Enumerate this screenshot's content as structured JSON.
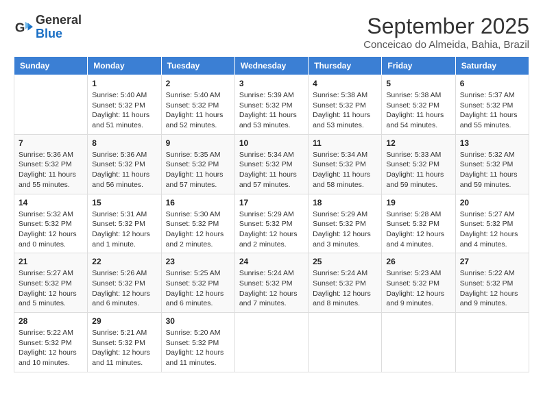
{
  "app": {
    "logo_line1": "General",
    "logo_line2": "Blue"
  },
  "header": {
    "month": "September 2025",
    "location": "Conceicao do Almeida, Bahia, Brazil"
  },
  "weekdays": [
    "Sunday",
    "Monday",
    "Tuesday",
    "Wednesday",
    "Thursday",
    "Friday",
    "Saturday"
  ],
  "weeks": [
    [
      {
        "day": "",
        "info": ""
      },
      {
        "day": "1",
        "info": "Sunrise: 5:40 AM\nSunset: 5:32 PM\nDaylight: 11 hours\nand 51 minutes."
      },
      {
        "day": "2",
        "info": "Sunrise: 5:40 AM\nSunset: 5:32 PM\nDaylight: 11 hours\nand 52 minutes."
      },
      {
        "day": "3",
        "info": "Sunrise: 5:39 AM\nSunset: 5:32 PM\nDaylight: 11 hours\nand 53 minutes."
      },
      {
        "day": "4",
        "info": "Sunrise: 5:38 AM\nSunset: 5:32 PM\nDaylight: 11 hours\nand 53 minutes."
      },
      {
        "day": "5",
        "info": "Sunrise: 5:38 AM\nSunset: 5:32 PM\nDaylight: 11 hours\nand 54 minutes."
      },
      {
        "day": "6",
        "info": "Sunrise: 5:37 AM\nSunset: 5:32 PM\nDaylight: 11 hours\nand 55 minutes."
      }
    ],
    [
      {
        "day": "7",
        "info": "Sunrise: 5:36 AM\nSunset: 5:32 PM\nDaylight: 11 hours\nand 55 minutes."
      },
      {
        "day": "8",
        "info": "Sunrise: 5:36 AM\nSunset: 5:32 PM\nDaylight: 11 hours\nand 56 minutes."
      },
      {
        "day": "9",
        "info": "Sunrise: 5:35 AM\nSunset: 5:32 PM\nDaylight: 11 hours\nand 57 minutes."
      },
      {
        "day": "10",
        "info": "Sunrise: 5:34 AM\nSunset: 5:32 PM\nDaylight: 11 hours\nand 57 minutes."
      },
      {
        "day": "11",
        "info": "Sunrise: 5:34 AM\nSunset: 5:32 PM\nDaylight: 11 hours\nand 58 minutes."
      },
      {
        "day": "12",
        "info": "Sunrise: 5:33 AM\nSunset: 5:32 PM\nDaylight: 11 hours\nand 59 minutes."
      },
      {
        "day": "13",
        "info": "Sunrise: 5:32 AM\nSunset: 5:32 PM\nDaylight: 11 hours\nand 59 minutes."
      }
    ],
    [
      {
        "day": "14",
        "info": "Sunrise: 5:32 AM\nSunset: 5:32 PM\nDaylight: 12 hours\nand 0 minutes."
      },
      {
        "day": "15",
        "info": "Sunrise: 5:31 AM\nSunset: 5:32 PM\nDaylight: 12 hours\nand 1 minute."
      },
      {
        "day": "16",
        "info": "Sunrise: 5:30 AM\nSunset: 5:32 PM\nDaylight: 12 hours\nand 2 minutes."
      },
      {
        "day": "17",
        "info": "Sunrise: 5:29 AM\nSunset: 5:32 PM\nDaylight: 12 hours\nand 2 minutes."
      },
      {
        "day": "18",
        "info": "Sunrise: 5:29 AM\nSunset: 5:32 PM\nDaylight: 12 hours\nand 3 minutes."
      },
      {
        "day": "19",
        "info": "Sunrise: 5:28 AM\nSunset: 5:32 PM\nDaylight: 12 hours\nand 4 minutes."
      },
      {
        "day": "20",
        "info": "Sunrise: 5:27 AM\nSunset: 5:32 PM\nDaylight: 12 hours\nand 4 minutes."
      }
    ],
    [
      {
        "day": "21",
        "info": "Sunrise: 5:27 AM\nSunset: 5:32 PM\nDaylight: 12 hours\nand 5 minutes."
      },
      {
        "day": "22",
        "info": "Sunrise: 5:26 AM\nSunset: 5:32 PM\nDaylight: 12 hours\nand 6 minutes."
      },
      {
        "day": "23",
        "info": "Sunrise: 5:25 AM\nSunset: 5:32 PM\nDaylight: 12 hours\nand 6 minutes."
      },
      {
        "day": "24",
        "info": "Sunrise: 5:24 AM\nSunset: 5:32 PM\nDaylight: 12 hours\nand 7 minutes."
      },
      {
        "day": "25",
        "info": "Sunrise: 5:24 AM\nSunset: 5:32 PM\nDaylight: 12 hours\nand 8 minutes."
      },
      {
        "day": "26",
        "info": "Sunrise: 5:23 AM\nSunset: 5:32 PM\nDaylight: 12 hours\nand 9 minutes."
      },
      {
        "day": "27",
        "info": "Sunrise: 5:22 AM\nSunset: 5:32 PM\nDaylight: 12 hours\nand 9 minutes."
      }
    ],
    [
      {
        "day": "28",
        "info": "Sunrise: 5:22 AM\nSunset: 5:32 PM\nDaylight: 12 hours\nand 10 minutes."
      },
      {
        "day": "29",
        "info": "Sunrise: 5:21 AM\nSunset: 5:32 PM\nDaylight: 12 hours\nand 11 minutes."
      },
      {
        "day": "30",
        "info": "Sunrise: 5:20 AM\nSunset: 5:32 PM\nDaylight: 12 hours\nand 11 minutes."
      },
      {
        "day": "",
        "info": ""
      },
      {
        "day": "",
        "info": ""
      },
      {
        "day": "",
        "info": ""
      },
      {
        "day": "",
        "info": ""
      }
    ]
  ]
}
